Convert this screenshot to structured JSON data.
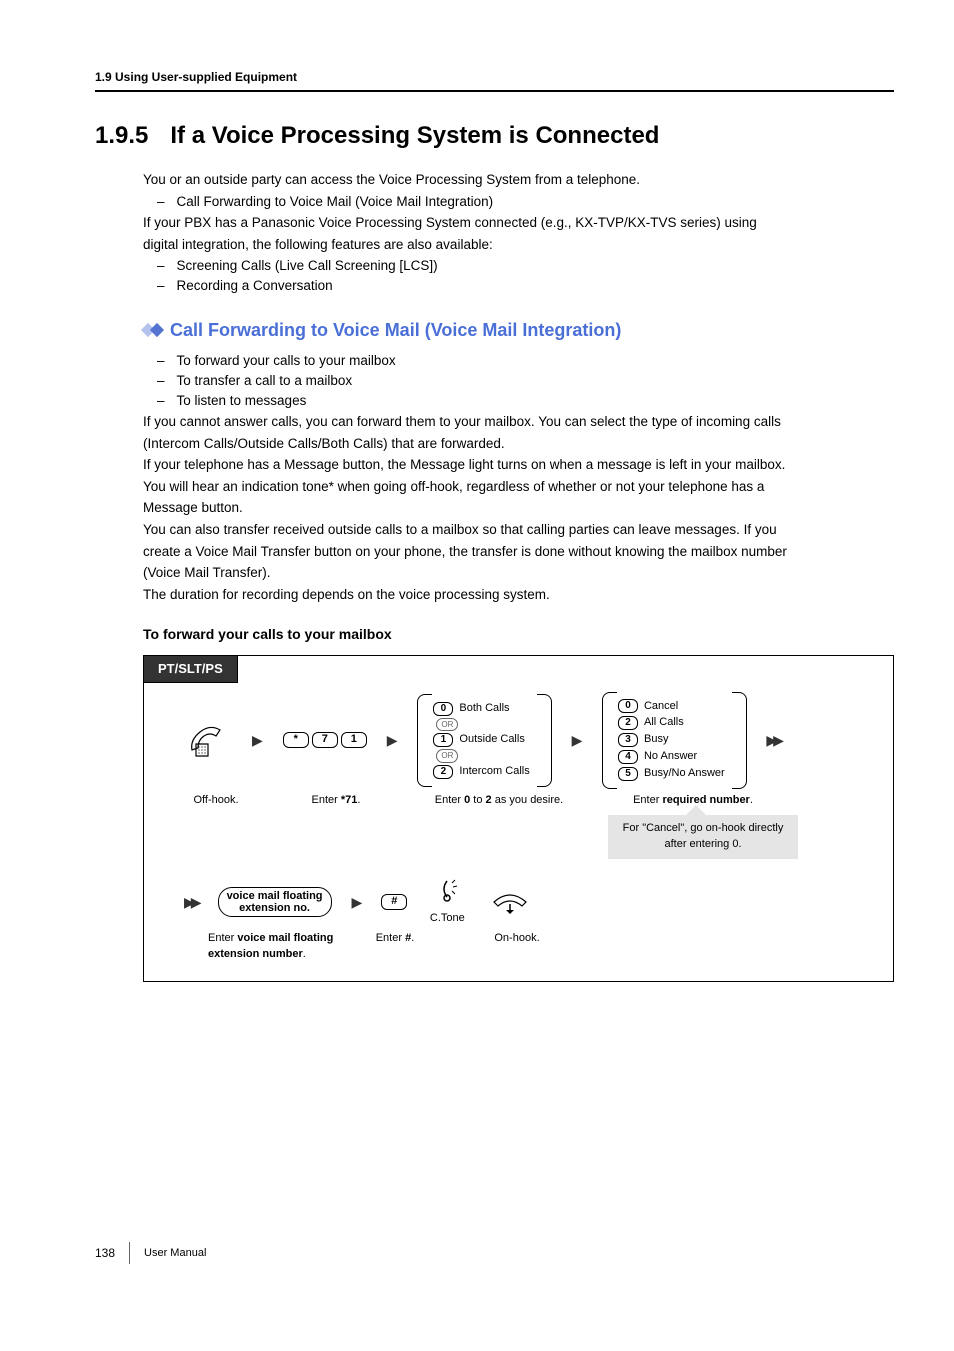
{
  "header": {
    "section": "1.9 Using User-supplied Equipment"
  },
  "title": {
    "num": "1.9.5",
    "text": "If a Voice Processing System is Connected"
  },
  "intro": {
    "l1": "You or an outside party can access the Voice Processing System from a telephone.",
    "b1": "Call Forwarding to Voice Mail (Voice Mail Integration)",
    "l2a": "If your PBX has a Panasonic Voice Processing System connected (e.g., KX-TVP/KX-TVS series) using",
    "l2b": "digital integration, the following features are also available:",
    "b2": "Screening Calls (Live Call Screening [LCS])",
    "b3": "Recording a Conversation"
  },
  "subsection": {
    "title": "Call Forwarding to Voice Mail (Voice Mail Integration)"
  },
  "subs_list": {
    "i1": "To forward your calls to your mailbox",
    "i2": "To transfer a call to a mailbox",
    "i3": "To listen to messages"
  },
  "para": {
    "p1a": "If you cannot answer calls, you can forward them to your mailbox. You can select the type of incoming calls",
    "p1b": "(Intercom Calls/Outside Calls/Both Calls) that are forwarded.",
    "p2a": "If your telephone has a Message button, the Message light turns on when a message is left in your mailbox.",
    "p2b": "You will hear an indication tone* when going off-hook, regardless of whether or not your telephone has a",
    "p2c": "Message button.",
    "p3a": "You can also transfer received outside calls to a mailbox so that calling parties can leave messages. If you",
    "p3b": "create a Voice Mail Transfer button on your phone, the transfer is done without knowing the mailbox number",
    "p3c": "(Voice Mail Transfer).",
    "p4": "The duration for recording depends on the voice processing system."
  },
  "procedure": {
    "title": "To forward your calls to your mailbox"
  },
  "diagram": {
    "tab": "PT/SLT/PS",
    "offhook_cap": "Off-hook.",
    "code": {
      "k1": "*",
      "k2": "7",
      "k3": "1",
      "cap_a": "Enter ",
      "cap_b": "*71",
      "cap_c": "."
    },
    "optA": {
      "r1": {
        "key": "0",
        "label": "Both Calls"
      },
      "or1": "OR",
      "r2": {
        "key": "1",
        "label": "Outside Calls"
      },
      "or2": "OR",
      "r3": {
        "key": "2",
        "label": "Intercom Calls"
      },
      "cap_a": "Enter ",
      "cap_b": "0",
      "cap_c": " to ",
      "cap_d": "2",
      "cap_e": " as you desire."
    },
    "optB": {
      "r1": {
        "key": "0",
        "label": "Cancel"
      },
      "r2": {
        "key": "2",
        "label": "All Calls"
      },
      "r3": {
        "key": "3",
        "label": "Busy"
      },
      "r4": {
        "key": "4",
        "label": "No Answer"
      },
      "r5": {
        "key": "5",
        "label": "Busy/No Answer"
      },
      "cap_a": "Enter ",
      "cap_b": "required number",
      "cap_c": "."
    },
    "note": "For \"Cancel\", go on-hook directly after entering 0.",
    "vm": {
      "pill1": "voice mail floating",
      "pill2": "extension no.",
      "cap_a": "Enter ",
      "cap_b": "voice mail floating",
      "cap_c": "extension number",
      "cap_d": "."
    },
    "hash": {
      "key": "#",
      "cap_a": "Enter ",
      "cap_b": "#",
      "cap_c": "."
    },
    "ctone": {
      "label": "C.Tone"
    },
    "onhook": {
      "cap": "On-hook."
    }
  },
  "footer": {
    "page": "138",
    "label": "User Manual"
  }
}
